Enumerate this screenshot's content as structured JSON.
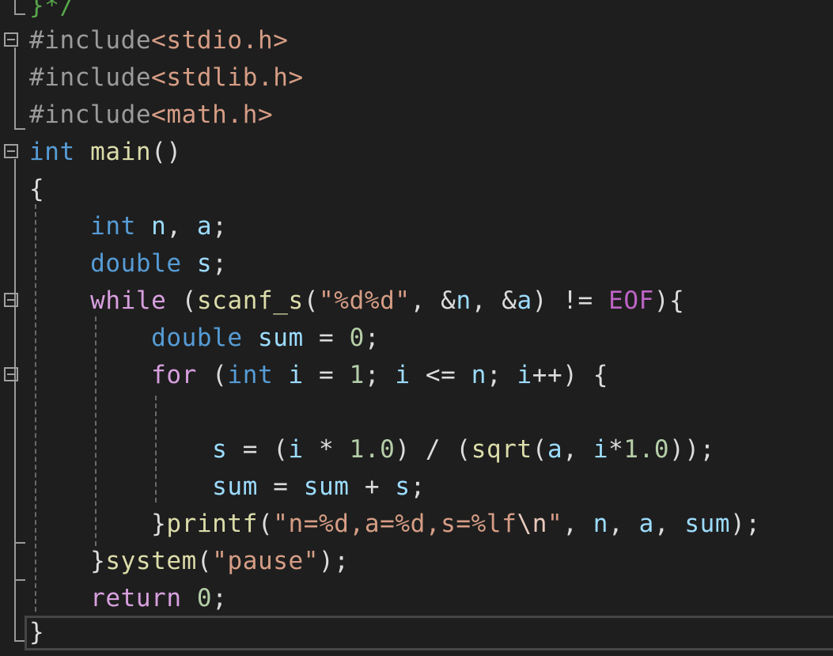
{
  "colors": {
    "background": "#1e1e1e",
    "keyword": "#569cd6",
    "control": "#d8a0df",
    "function": "#dcdcaa",
    "variable": "#9cdcfe",
    "string": "#d69d85",
    "number": "#b5cea8",
    "preprocessor": "#9b9b9b",
    "plain": "#dcdcdc",
    "escape": "#e8c9bb",
    "macro": "#bd63c5"
  },
  "code": {
    "l0": {
      "comment": "}*/"
    },
    "l1": {
      "directive": "#include",
      "lt": "<",
      "file": "stdio.h",
      "gt": ">"
    },
    "l2": {
      "directive": "#include",
      "lt": "<",
      "file": "stdlib.h",
      "gt": ">"
    },
    "l3": {
      "directive": "#include",
      "lt": "<",
      "file": "math.h",
      "gt": ">"
    },
    "l4": {
      "kw": "int",
      "name": "main",
      "paren": "()"
    },
    "l5": {
      "brace": "{"
    },
    "l6": {
      "kw": "int",
      "v1": "n",
      "c1": ", ",
      "v2": "a",
      "end": ";"
    },
    "l7": {
      "kw": "double",
      "v1": "s",
      "end": ";"
    },
    "l8": {
      "kw": "while",
      "p1": " (",
      "fn": "scanf_s",
      "p2": "(",
      "str": "\"%d%d\"",
      "c1": ", ",
      "amp1": "&",
      "v1": "n",
      "c2": ", ",
      "amp2": "&",
      "v2": "a",
      "p3": ") != ",
      "macro": "EOF",
      "p4": "){"
    },
    "l9": {
      "kw": "double",
      "v1": "sum",
      "op": " = ",
      "num": "0",
      "end": ";"
    },
    "l10": {
      "kw": "for",
      "p1": " (",
      "kw2": "int",
      "v1": "i",
      "op1": " = ",
      "n1": "1",
      "s1": "; ",
      "v2": "i",
      "op2": " <= ",
      "v3": "n",
      "s2": "; ",
      "v4": "i",
      "op3": "++) {"
    },
    "l11": {},
    "l12": {
      "v1": "s",
      "op1": " = (",
      "v2": "i",
      "op2": " * ",
      "n1": "1.0",
      "op3": ") / (",
      "fn": "sqrt",
      "p1": "(",
      "v3": "a",
      "c1": ", ",
      "v4": "i",
      "op4": "*",
      "n2": "1.0",
      "end": "));"
    },
    "l13": {
      "v1": "sum",
      "op1": " = ",
      "v2": "sum",
      "op2": " + ",
      "v3": "s",
      "end": ";"
    },
    "l14": {
      "brace": "}",
      "fn": "printf",
      "p1": "(",
      "str1": "\"n=%d,a=%d,s=%lf",
      "esc": "\\n",
      "str2": "\"",
      "c1": ", ",
      "v1": "n",
      "c2": ", ",
      "v2": "a",
      "c3": ", ",
      "v3": "sum",
      "end": ");"
    },
    "l15": {
      "brace": "}",
      "fn": "system",
      "p1": "(",
      "str": "\"pause\"",
      "end": ");"
    },
    "l16": {
      "kw": "return",
      "sp": " ",
      "num": "0",
      "end": ";"
    },
    "l17": {
      "brace": "}"
    }
  }
}
